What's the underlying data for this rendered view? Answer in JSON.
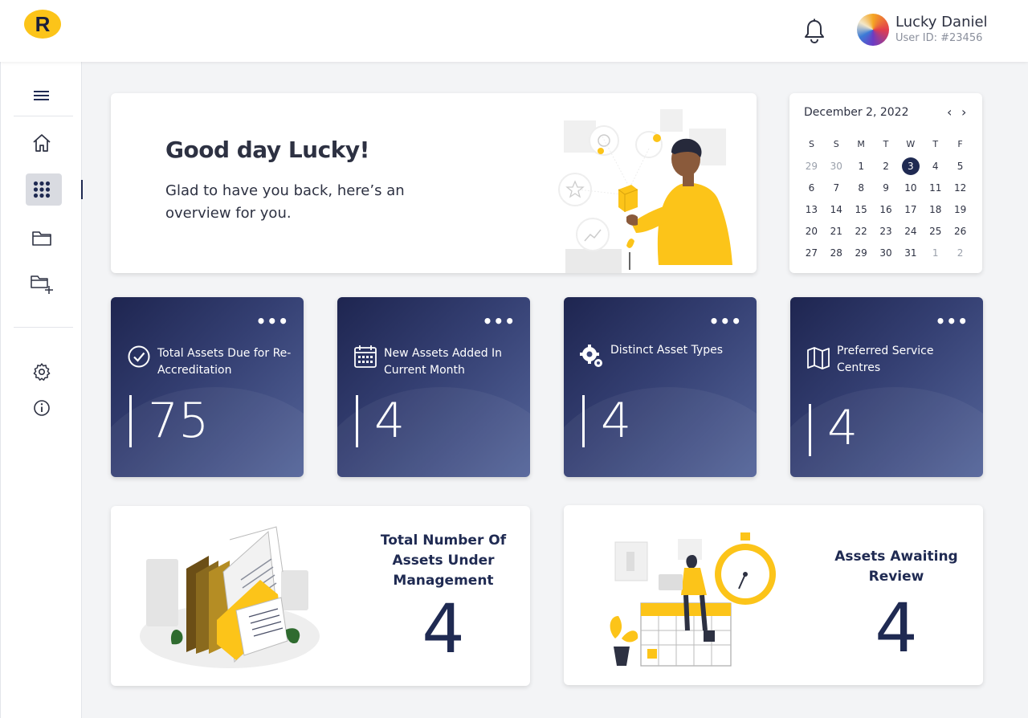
{
  "header": {
    "logo_letter": "R",
    "user_name": "Lucky Daniel",
    "user_id": "User ID: #23456"
  },
  "sidebar": {
    "items": [
      {
        "icon": "menu-icon"
      },
      {
        "icon": "home-icon"
      },
      {
        "icon": "grid-icon",
        "active": true
      },
      {
        "icon": "folder-icon"
      },
      {
        "icon": "folder-add-icon"
      },
      {
        "icon": "gear-icon"
      },
      {
        "icon": "info-icon"
      }
    ]
  },
  "greeting": {
    "title": "Good day Lucky!",
    "subtitle": "Glad to have you back, here’s an overview for you."
  },
  "calendar": {
    "month_label": "December 2, 2022",
    "prev": "‹",
    "next": "›",
    "weekdays": [
      "S",
      "S",
      "M",
      "T",
      "W",
      "T",
      "F"
    ],
    "weeks": [
      [
        {
          "d": "29",
          "m": true
        },
        {
          "d": "30",
          "m": true
        },
        {
          "d": "1"
        },
        {
          "d": "2"
        },
        {
          "d": "3",
          "today": true
        },
        {
          "d": "4"
        },
        {
          "d": "5"
        }
      ],
      [
        {
          "d": "6"
        },
        {
          "d": "7"
        },
        {
          "d": "8"
        },
        {
          "d": "9"
        },
        {
          "d": "10"
        },
        {
          "d": "11"
        },
        {
          "d": "12"
        }
      ],
      [
        {
          "d": "13"
        },
        {
          "d": "14"
        },
        {
          "d": "15"
        },
        {
          "d": "16"
        },
        {
          "d": "17"
        },
        {
          "d": "18"
        },
        {
          "d": "19"
        }
      ],
      [
        {
          "d": "20"
        },
        {
          "d": "21"
        },
        {
          "d": "22"
        },
        {
          "d": "23"
        },
        {
          "d": "24"
        },
        {
          "d": "25"
        },
        {
          "d": "26"
        }
      ],
      [
        {
          "d": "27"
        },
        {
          "d": "28"
        },
        {
          "d": "29"
        },
        {
          "d": "30"
        },
        {
          "d": "31"
        },
        {
          "d": "1",
          "m": true
        },
        {
          "d": "2",
          "m": true
        }
      ]
    ]
  },
  "stats": [
    {
      "label": "Total Assets Due for Re-Accreditation",
      "value": "75",
      "icon": "check-circle-icon",
      "more": "•••"
    },
    {
      "label": "New Assets Added In Current Month",
      "value": "4",
      "icon": "calendar-icon",
      "more": "•••"
    },
    {
      "label": "Distinct Asset Types",
      "value": "4",
      "icon": "gears-icon",
      "more": "•••"
    },
    {
      "label": "Preferred Service Centres",
      "value": "4",
      "icon": "map-icon",
      "more": "•••"
    }
  ],
  "summary": [
    {
      "title": "Total Number Of Assets Under Management",
      "value": "4"
    },
    {
      "title": "Assets Awaiting Review",
      "value": "4"
    }
  ],
  "colors": {
    "accent": "#fcc419",
    "navy": "#1f2a52"
  }
}
